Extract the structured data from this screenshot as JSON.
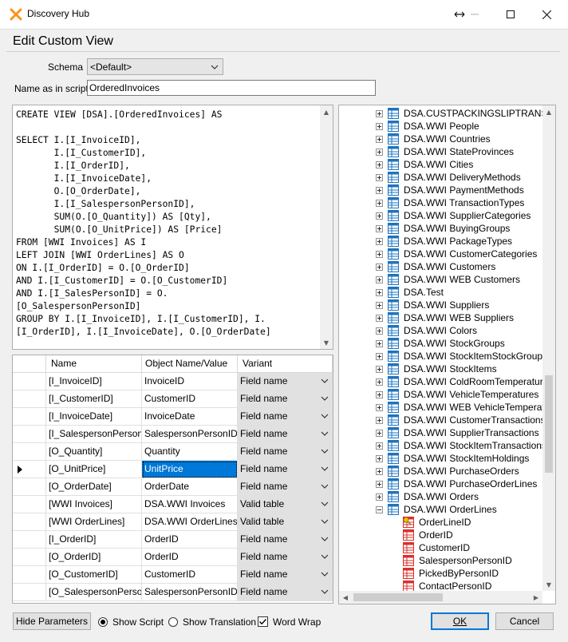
{
  "window": {
    "title": "Discovery Hub",
    "controls": {
      "restore_icon": "double-arrow-icon",
      "minimize_icon": "minimize-icon",
      "maximize_icon": "maximize-icon",
      "close_icon": "close-icon"
    }
  },
  "header": {
    "title": "Edit Custom View"
  },
  "form": {
    "schema_label": "Schema",
    "schema_value": "<Default>",
    "name_label": "Name as in script",
    "name_value": "OrderedInvoices"
  },
  "script": {
    "lines": [
      "CREATE VIEW [DSA].[OrderedInvoices] AS",
      "",
      "SELECT I.[I_InvoiceID],",
      "       I.[I_CustomerID],",
      "       I.[I_OrderID],",
      "       I.[I_InvoiceDate],",
      "       O.[O_OrderDate],",
      "       I.[I_SalespersonPersonID],",
      "       SUM(O.[O_Quantity]) AS [Qty],",
      "       SUM(O.[O_UnitPrice]) AS [Price]",
      "FROM [WWI Invoices] AS I",
      "LEFT JOIN [WWI OrderLines] AS O",
      "ON I.[I_OrderID] = O.[O_OrderID]",
      "AND I.[I_CustomerID] = O.[O_CustomerID]",
      "AND I.[I_SalesPersonID] = O.",
      "[O_SalespersonPersonID]",
      "GROUP BY I.[I_InvoiceID], I.[I_CustomerID], I.",
      "[I_OrderID], I.[I_InvoiceDate], O.[O_OrderDate]"
    ]
  },
  "grid": {
    "columns": [
      "Name",
      "Object Name/Value",
      "Variant"
    ],
    "rows": [
      {
        "name": "[I_InvoiceID]",
        "value": "InvoiceID",
        "variant": "Field name",
        "current": false
      },
      {
        "name": "[I_CustomerID]",
        "value": "CustomerID",
        "variant": "Field name",
        "current": false
      },
      {
        "name": "[I_InvoiceDate]",
        "value": "InvoiceDate",
        "variant": "Field name",
        "current": false
      },
      {
        "name": "[I_SalespersonPerson...",
        "value": "SalespersonPersonID",
        "variant": "Field name",
        "current": false
      },
      {
        "name": "[O_Quantity]",
        "value": "Quantity",
        "variant": "Field name",
        "current": false
      },
      {
        "name": "[O_UnitPrice]",
        "value": "UnitPrice",
        "variant": "Field name",
        "current": true
      },
      {
        "name": "[O_OrderDate]",
        "value": "OrderDate",
        "variant": "Field name",
        "current": false
      },
      {
        "name": "[WWI Invoices]",
        "value": "DSA.WWI Invoices",
        "variant": "Valid table",
        "current": false
      },
      {
        "name": "[WWI OrderLines]",
        "value": "DSA.WWI OrderLines",
        "variant": "Valid table",
        "current": false
      },
      {
        "name": "[I_OrderID]",
        "value": "OrderID",
        "variant": "Field name",
        "current": false
      },
      {
        "name": "[O_OrderID]",
        "value": "OrderID",
        "variant": "Field name",
        "current": false
      },
      {
        "name": "[O_CustomerID]",
        "value": "CustomerID",
        "variant": "Field name",
        "current": false
      },
      {
        "name": "[O_SalespersonPerso...",
        "value": "SalespersonPersonID",
        "variant": "Field name",
        "current": false
      }
    ]
  },
  "tree": {
    "tables": [
      {
        "label": "DSA.CUSTPACKINGSLIPTRANS",
        "expanded": false
      },
      {
        "label": "DSA.WWI People",
        "expanded": false
      },
      {
        "label": "DSA.WWI Countries",
        "expanded": false
      },
      {
        "label": "DSA.WWI StateProvinces",
        "expanded": false
      },
      {
        "label": "DSA.WWI Cities",
        "expanded": false
      },
      {
        "label": "DSA.WWI DeliveryMethods",
        "expanded": false
      },
      {
        "label": "DSA.WWI PaymentMethods",
        "expanded": false
      },
      {
        "label": "DSA.WWI TransactionTypes",
        "expanded": false
      },
      {
        "label": "DSA.WWI SupplierCategories",
        "expanded": false
      },
      {
        "label": "DSA.WWI BuyingGroups",
        "expanded": false
      },
      {
        "label": "DSA.WWI PackageTypes",
        "expanded": false
      },
      {
        "label": "DSA.WWI CustomerCategories",
        "expanded": false
      },
      {
        "label": "DSA.WWI Customers",
        "expanded": false
      },
      {
        "label": "DSA.WWI WEB Customers",
        "expanded": false
      },
      {
        "label": "DSA.Test",
        "expanded": false
      },
      {
        "label": "DSA.WWI Suppliers",
        "expanded": false
      },
      {
        "label": "DSA.WWI WEB Suppliers",
        "expanded": false
      },
      {
        "label": "DSA.WWI Colors",
        "expanded": false
      },
      {
        "label": "DSA.WWI StockGroups",
        "expanded": false
      },
      {
        "label": "DSA.WWI StockItemStockGroups",
        "expanded": false
      },
      {
        "label": "DSA.WWI StockItems",
        "expanded": false
      },
      {
        "label": "DSA.WWI ColdRoomTemperatures",
        "expanded": false
      },
      {
        "label": "DSA.WWI VehicleTemperatures",
        "expanded": false
      },
      {
        "label": "DSA.WWI WEB VehicleTemperatures",
        "expanded": false
      },
      {
        "label": "DSA.WWI CustomerTransactions",
        "expanded": false
      },
      {
        "label": "DSA.WWI SupplierTransactions",
        "expanded": false
      },
      {
        "label": "DSA.WWI StockItemTransactions",
        "expanded": false
      },
      {
        "label": "DSA.WWI StockItemHoldings",
        "expanded": false
      },
      {
        "label": "DSA.WWI PurchaseOrders",
        "expanded": false
      },
      {
        "label": "DSA.WWI PurchaseOrderLines",
        "expanded": false
      },
      {
        "label": "DSA.WWI Orders",
        "expanded": false
      },
      {
        "label": "DSA.WWI OrderLines",
        "expanded": true
      }
    ],
    "fields": [
      {
        "label": "OrderLineID",
        "icon": "key-field-icon"
      },
      {
        "label": "OrderID",
        "icon": "field-icon"
      },
      {
        "label": "CustomerID",
        "icon": "field-icon"
      },
      {
        "label": "SalespersonPersonID",
        "icon": "field-icon"
      },
      {
        "label": "PickedByPersonID",
        "icon": "field-icon"
      },
      {
        "label": "ContactPersonID",
        "icon": "field-icon"
      }
    ]
  },
  "footer": {
    "hide_parameters": "Hide Parameters",
    "show_script": "Show Script",
    "show_translation": "Show Translation",
    "word_wrap": "Word Wrap",
    "ok": "OK",
    "cancel": "Cancel"
  },
  "colors": {
    "accent": "#0078d7",
    "title_icon": "#f7941d",
    "table_icon": "#1e73be",
    "field_icon": "#d9302c"
  }
}
